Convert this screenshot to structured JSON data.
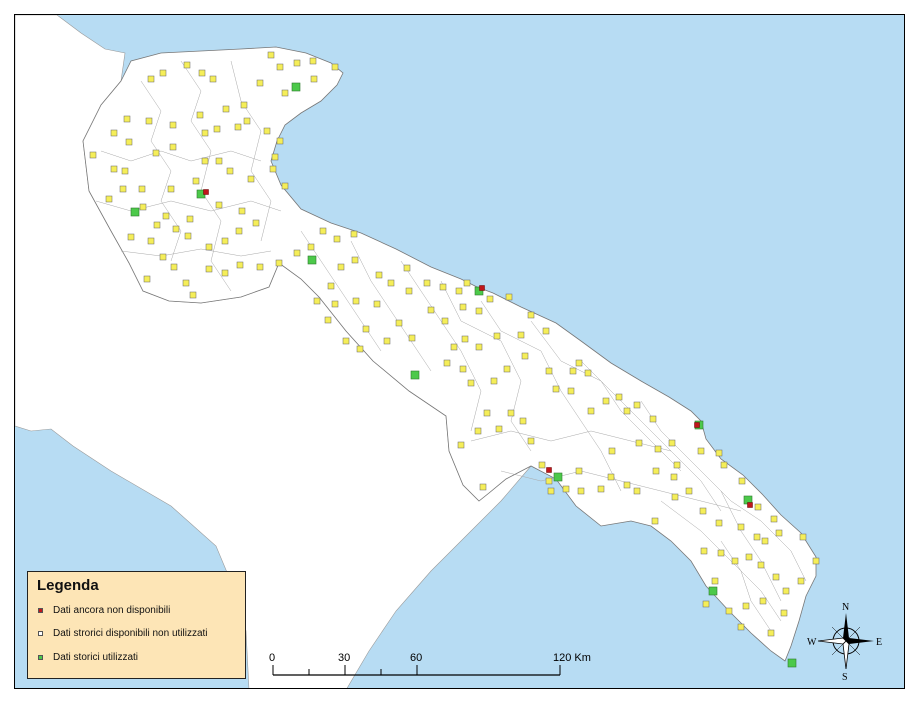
{
  "legend": {
    "title": "Legenda",
    "items": [
      {
        "label": "Dati ancora non disponibili",
        "color": "#c0161b"
      },
      {
        "label": "Dati strorici disponibili non utilizzati",
        "color": "#ffffff"
      },
      {
        "label": "Dati storici utilizzati",
        "color": "#4cc94a"
      }
    ]
  },
  "scale_bar": {
    "ticks": [
      "0",
      "30",
      "60",
      "120 Km"
    ]
  },
  "compass": {
    "north": "N",
    "south": "S",
    "east": "E",
    "west": "W"
  },
  "colors": {
    "sea": "#b7dcf3",
    "land_puglia": "#ffffff",
    "land_other": "#ffffff",
    "station_yellow": "#f5ee58",
    "station_green": "#4cc94a",
    "station_red": "#c0161b",
    "legend_bg": "#fde5b6"
  }
}
